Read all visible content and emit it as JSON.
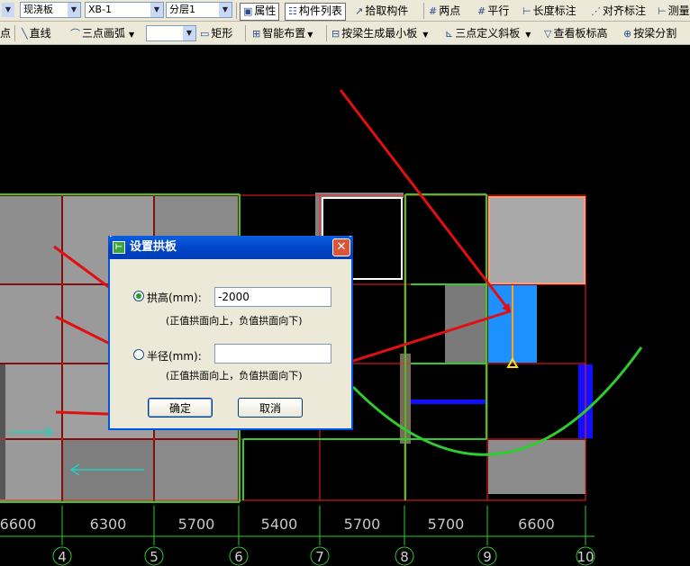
{
  "toolbar1": {
    "type_value": "现浇板",
    "component_value": "XB-1",
    "layer_value": "分层1",
    "properties_label": "属性",
    "component_list_label": "构件列表",
    "pick_component_label": "拾取构件",
    "two_points_label": "两点",
    "parallel_label": "平行",
    "length_dim_label": "长度标注",
    "aligned_dim_label": "对齐标注",
    "measure_label": "测量"
  },
  "toolbar2": {
    "point_label": "点",
    "line_label": "直线",
    "arc_label": "三点画弧",
    "rect_label": "矩形",
    "smart_layout_label": "智能布置",
    "by_beam_label": "按梁生成最小板",
    "slope_label": "三点定义斜板",
    "view_height_label": "查看板标高",
    "split_label": "按梁分割"
  },
  "canvas": {
    "dimensions": [
      "6600",
      "6300",
      "5700",
      "5400",
      "5700",
      "5700",
      "6600"
    ],
    "axes": [
      "4",
      "5",
      "6",
      "7",
      "8",
      "9",
      "10"
    ],
    "colors": {
      "grid": "#ff2020",
      "beam": "#2ecc2e",
      "slab": "#9a9a9a",
      "highlight": "#1e90ff",
      "arrow": "#e01010"
    }
  },
  "dialog": {
    "title": "设置拱板",
    "arch_height_label": "拱高(mm):",
    "arch_height_value": "-2000",
    "arch_height_hint": "(正值拱面向上，负值拱面向下)",
    "radius_label": "半径(mm):",
    "radius_value": "",
    "radius_hint": "(正值拱面向上，负值拱面向下)",
    "ok_label": "确定",
    "cancel_label": "取消"
  }
}
